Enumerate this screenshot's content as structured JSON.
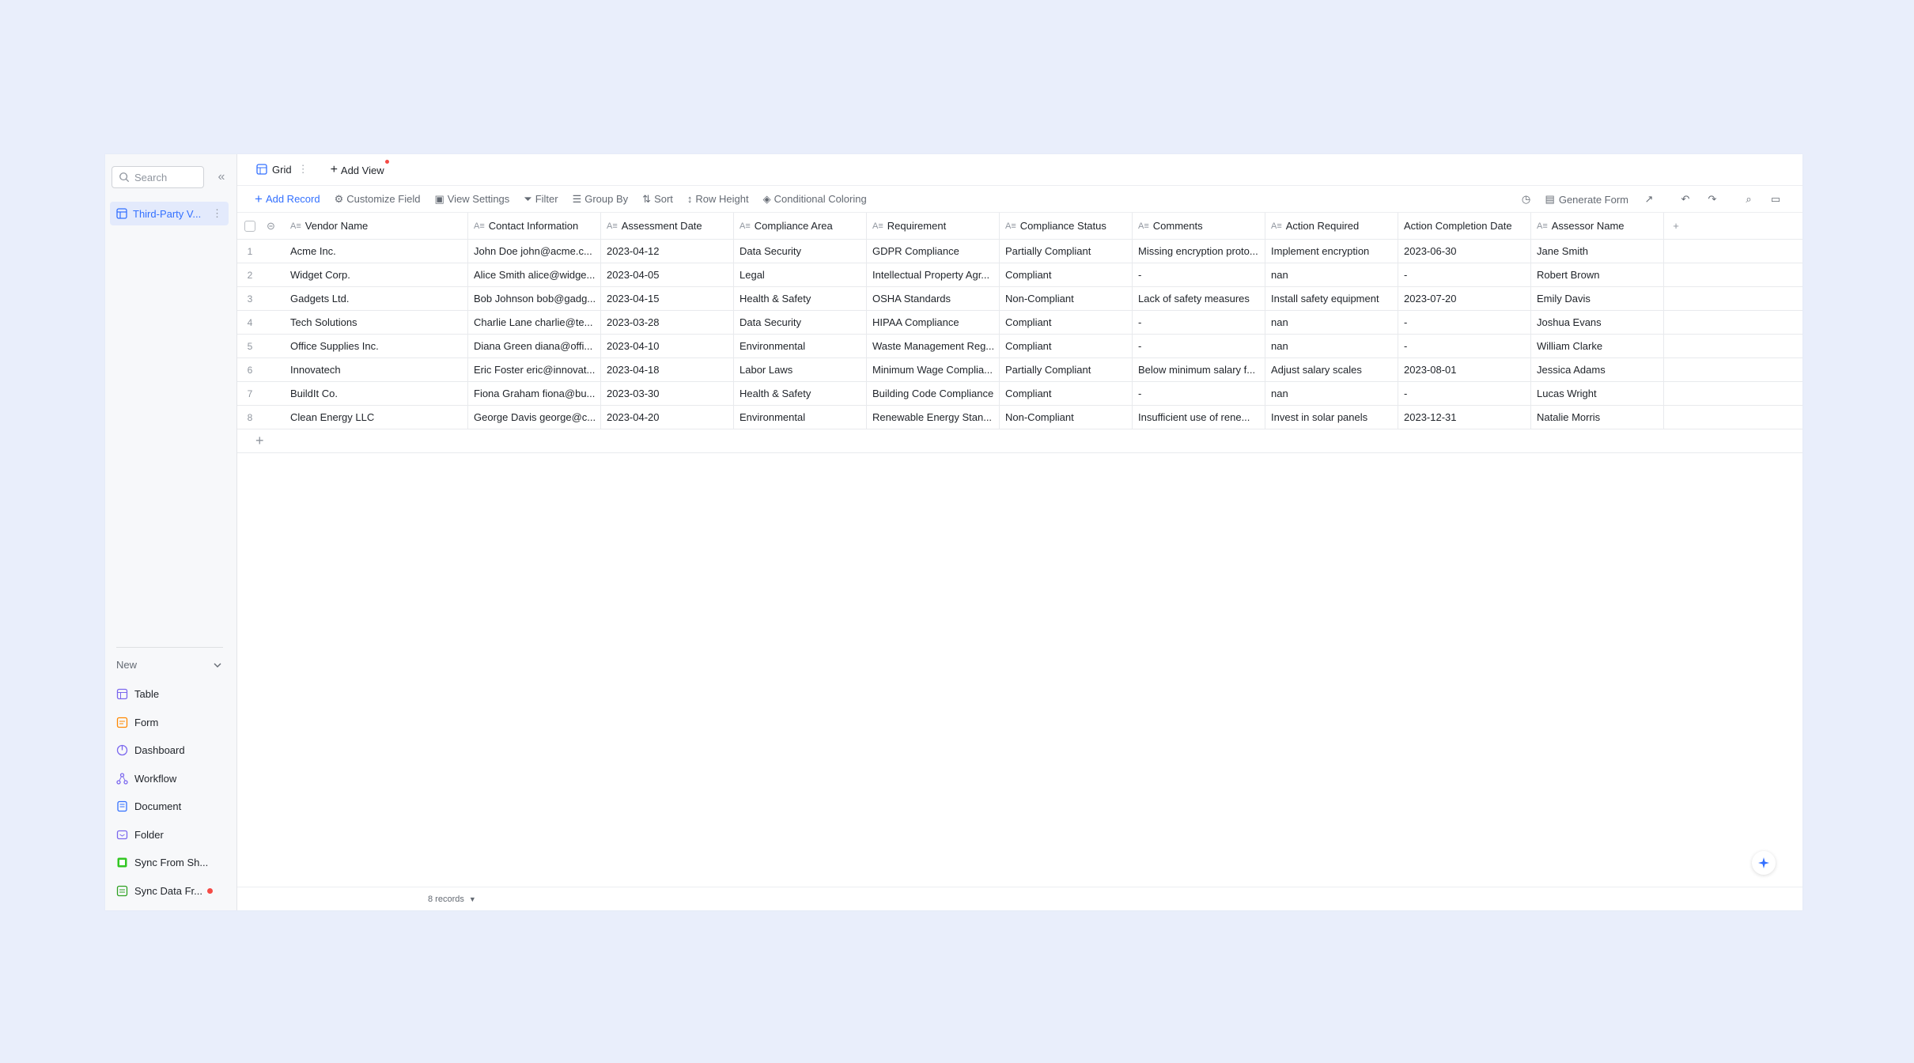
{
  "sidebar": {
    "search_placeholder": "Search",
    "collapse_glyph": "«",
    "table_item": "Third-Party V...",
    "new_label": "New",
    "new_items": [
      {
        "label": "Table",
        "icon": "table-icon",
        "color": "#7b67ee"
      },
      {
        "label": "Form",
        "icon": "form-icon",
        "color": "#ff8800"
      },
      {
        "label": "Dashboard",
        "icon": "dashboard-icon",
        "color": "#7b67ee"
      },
      {
        "label": "Workflow",
        "icon": "workflow-icon",
        "color": "#7b67ee"
      },
      {
        "label": "Document",
        "icon": "document-icon",
        "color": "#3370ff"
      },
      {
        "label": "Folder",
        "icon": "folder-icon",
        "color": "#7b67ee"
      },
      {
        "label": "Sync From Sh...",
        "icon": "sync-sheet-icon",
        "color": "#34c724"
      },
      {
        "label": "Sync Data Fr...",
        "icon": "sync-data-icon",
        "color": "#2ea121"
      }
    ]
  },
  "tabs": {
    "grid": "Grid",
    "add_view": "Add View"
  },
  "toolbar": {
    "add_record": "Add Record",
    "customize_field": "Customize Field",
    "view_settings": "View Settings",
    "filter": "Filter",
    "group_by": "Group By",
    "sort": "Sort",
    "row_height": "Row Height",
    "conditional_coloring": "Conditional Coloring",
    "generate_form": "Generate Form"
  },
  "table": {
    "columns": [
      "Vendor Name",
      "Contact Information",
      "Assessment Date",
      "Compliance Area",
      "Requirement",
      "Compliance Status",
      "Comments",
      "Action Required",
      "Action Completion Date",
      "Assessor Name"
    ],
    "rows": [
      {
        "n": "1",
        "vendor": "Acme Inc.",
        "contact": "John Doe john@acme.c...",
        "date": "2023-04-12",
        "area": "Data Security",
        "req": "GDPR Compliance",
        "status": "Partially Compliant",
        "comments": "Missing encryption proto...",
        "action": "Implement encryption",
        "acd": "2023-06-30",
        "assessor": "Jane Smith"
      },
      {
        "n": "2",
        "vendor": "Widget Corp.",
        "contact": "Alice Smith alice@widge...",
        "date": "2023-04-05",
        "area": "Legal",
        "req": "Intellectual Property Agr...",
        "status": "Compliant",
        "comments": "-",
        "action": "nan",
        "acd": "-",
        "assessor": "Robert Brown"
      },
      {
        "n": "3",
        "vendor": "Gadgets Ltd.",
        "contact": "Bob Johnson bob@gadg...",
        "date": "2023-04-15",
        "area": "Health & Safety",
        "req": "OSHA Standards",
        "status": "Non-Compliant",
        "comments": "Lack of safety measures",
        "action": "Install safety equipment",
        "acd": "2023-07-20",
        "assessor": "Emily Davis"
      },
      {
        "n": "4",
        "vendor": "Tech Solutions",
        "contact": "Charlie Lane charlie@te...",
        "date": "2023-03-28",
        "area": "Data Security",
        "req": "HIPAA Compliance",
        "status": "Compliant",
        "comments": "-",
        "action": "nan",
        "acd": "-",
        "assessor": "Joshua Evans"
      },
      {
        "n": "5",
        "vendor": "Office Supplies Inc.",
        "contact": "Diana Green diana@offi...",
        "date": "2023-04-10",
        "area": "Environmental",
        "req": "Waste Management Reg...",
        "status": "Compliant",
        "comments": "-",
        "action": "nan",
        "acd": "-",
        "assessor": "William Clarke"
      },
      {
        "n": "6",
        "vendor": "Innovatech",
        "contact": "Eric Foster eric@innovat...",
        "date": "2023-04-18",
        "area": "Labor Laws",
        "req": "Minimum Wage Complia...",
        "status": "Partially Compliant",
        "comments": "Below minimum salary f...",
        "action": "Adjust salary scales",
        "acd": "2023-08-01",
        "assessor": "Jessica Adams"
      },
      {
        "n": "7",
        "vendor": "BuildIt Co.",
        "contact": "Fiona Graham fiona@bu...",
        "date": "2023-03-30",
        "area": "Health & Safety",
        "req": "Building Code Compliance",
        "status": "Compliant",
        "comments": "-",
        "action": "nan",
        "acd": "-",
        "assessor": "Lucas Wright"
      },
      {
        "n": "8",
        "vendor": "Clean Energy LLC",
        "contact": "George Davis george@c...",
        "date": "2023-04-20",
        "area": "Environmental",
        "req": "Renewable Energy Stan...",
        "status": "Non-Compliant",
        "comments": "Insufficient use of rene...",
        "action": "Invest in solar panels",
        "acd": "2023-12-31",
        "assessor": "Natalie Morris"
      }
    ]
  },
  "footer": {
    "records": "8 records"
  },
  "colors": {
    "accent": "#3370ff",
    "background": "#e9eefb",
    "badge": "#f54a45"
  }
}
